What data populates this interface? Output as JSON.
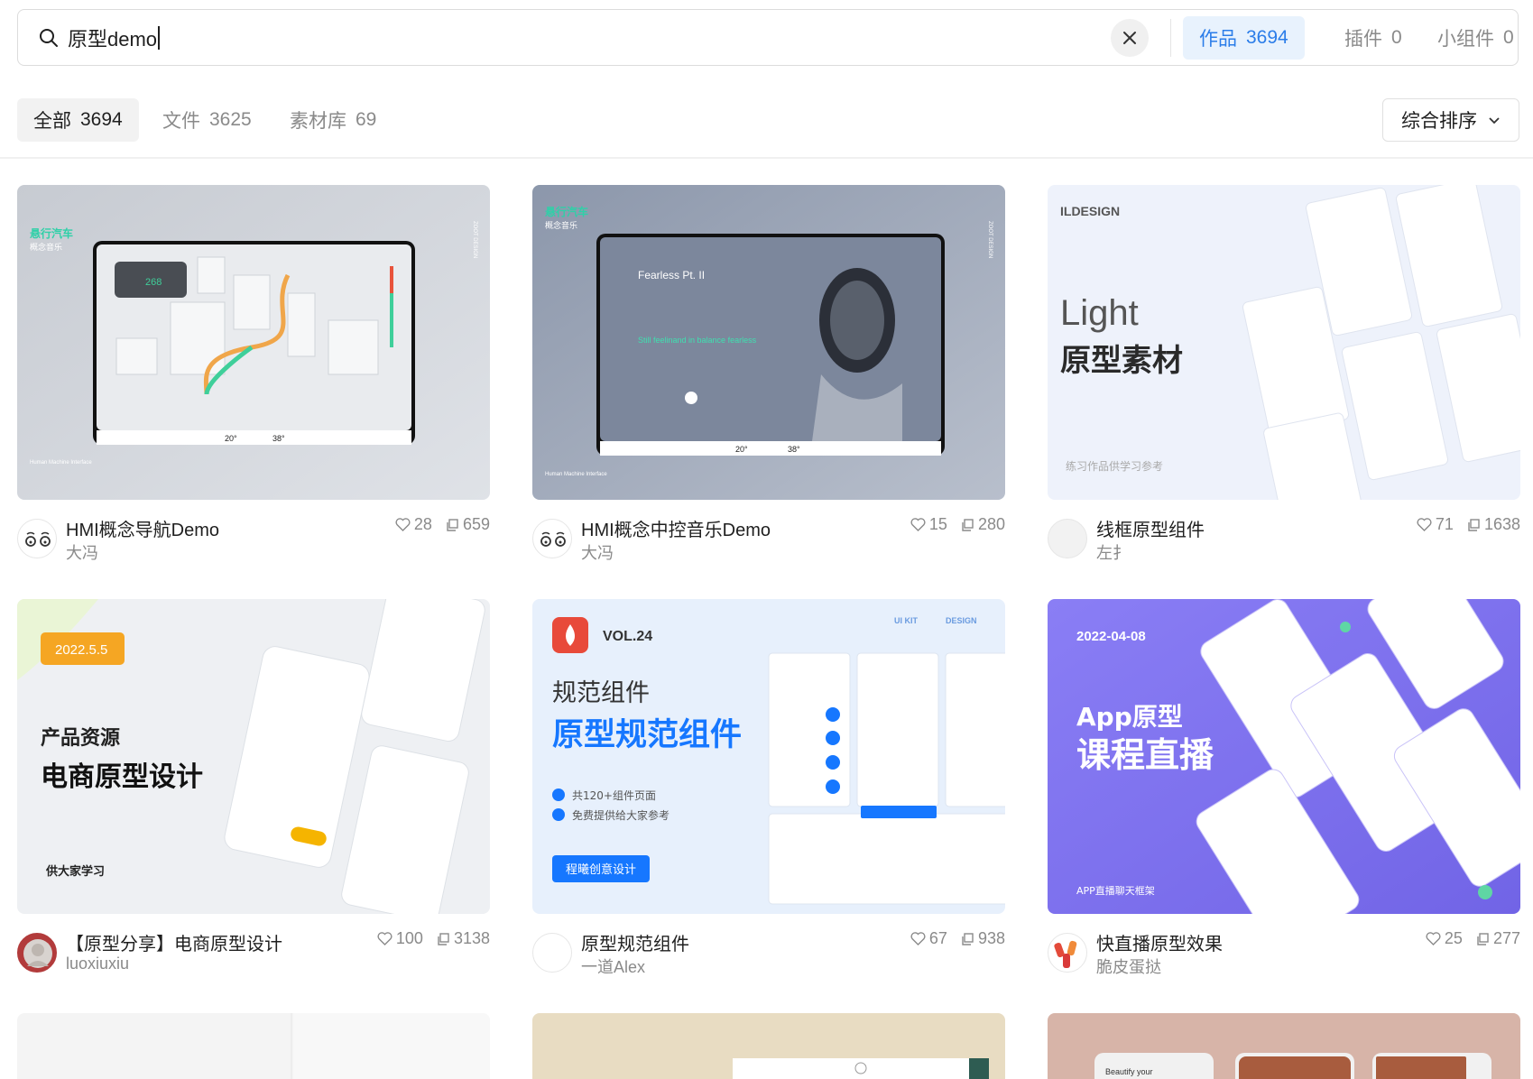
{
  "search": {
    "query": "原型demo",
    "tabs": [
      {
        "label": "作品",
        "count": "3694"
      },
      {
        "label": "插件",
        "count": "0"
      },
      {
        "label": "小组件",
        "count": "0"
      }
    ]
  },
  "filters": {
    "tabs": [
      {
        "label": "全部",
        "count": "3694"
      },
      {
        "label": "文件",
        "count": "3625"
      },
      {
        "label": "素材库",
        "count": "69"
      }
    ],
    "sort_label": "综合排序"
  },
  "cards": [
    {
      "title": "HMI概念导航Demo",
      "author": "大冯",
      "likes": "28",
      "views": "659",
      "thumb": {
        "brand": "悬行汽车",
        "subtitle": "概念音乐",
        "footer": "Human Machine Interface",
        "side": "ZOOT DESIGN",
        "speed": "268",
        "temp1": "20°",
        "temp2": "38°"
      }
    },
    {
      "title": "HMI概念中控音乐Demo",
      "author": "大冯",
      "likes": "15",
      "views": "280",
      "thumb": {
        "brand": "悬行汽车",
        "subtitle": "概念音乐",
        "footer": "Human Machine Interface",
        "side": "ZOOT DESIGN",
        "song": "Fearless Pt. II",
        "lyric": "Still feelinand in balance fearless",
        "temp1": "20°",
        "temp2": "38°"
      }
    },
    {
      "title": "线框原型组件",
      "author": "左扌",
      "likes": "71",
      "views": "1638",
      "thumb": {
        "brand": "ILDESIGN",
        "line1": "Light",
        "line2": "原型素材",
        "note": "练习作品供学习参考"
      }
    },
    {
      "title": "【原型分享】电商原型设计",
      "author": "luoxiuxiu",
      "likes": "100",
      "views": "3138",
      "thumb": {
        "date": "2022.5.5",
        "line1": "产品资源",
        "line2": "电商原型设计",
        "note": "供大家学习"
      }
    },
    {
      "title": "原型规范组件",
      "author": "一道Alex",
      "likes": "67",
      "views": "938",
      "thumb": {
        "vol": "VOL.24",
        "kit": "UI KIT",
        "design": "DESIGN",
        "line1": "规范组件",
        "line2": "原型规范组件",
        "bullet1": "共120+组件页面",
        "bullet2": "免费提供给大家参考",
        "cta": "程曦创意设计"
      }
    },
    {
      "title": "快直播原型效果",
      "author": "脆皮蛋挞",
      "likes": "25",
      "views": "277",
      "thumb": {
        "date": "2022-04-08",
        "line1": "App原型",
        "line2": "课程直播",
        "note": "APP直播聊天框架"
      }
    }
  ],
  "partial_row": {
    "card3_text": "Beautify your"
  },
  "colors": {
    "accent": "#2b7de9",
    "accent_bg": "#e8f2fd",
    "purple": "#7b6ef0",
    "orange": "#f5a623"
  }
}
